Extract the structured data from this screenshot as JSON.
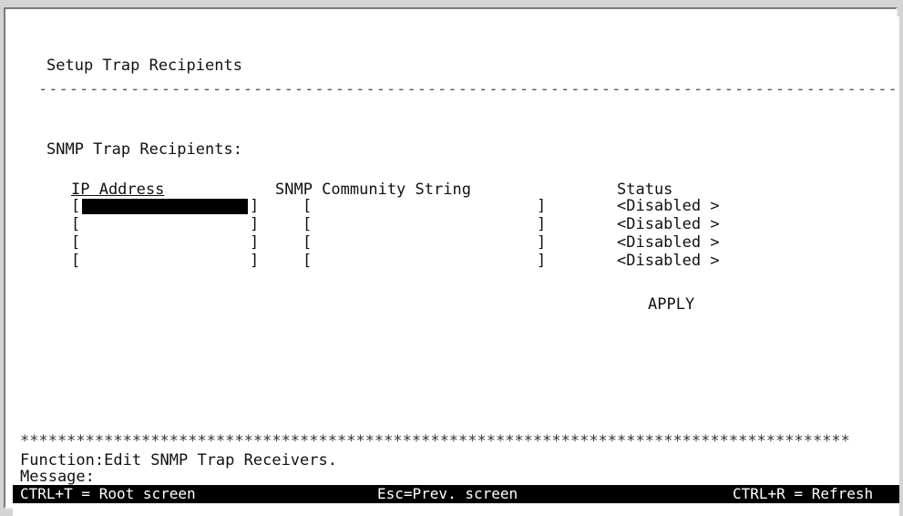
{
  "screen": {
    "title": "Setup Trap Recipients",
    "section_label": "SNMP Trap Recipients:",
    "columns": {
      "ip": "IP Address",
      "community": "SNMP Community String",
      "status": "Status"
    },
    "rows": [
      {
        "ip": "",
        "community": "",
        "status": "<Disabled >"
      },
      {
        "ip": "",
        "community": "",
        "status": "<Disabled >"
      },
      {
        "ip": "",
        "community": "",
        "status": "<Disabled >"
      },
      {
        "ip": "",
        "community": "",
        "status": "<Disabled >"
      }
    ],
    "apply_label": "APPLY",
    "function_text": "Function:Edit SNMP Trap Receivers.",
    "message_label": "Message:",
    "bottom_bar": {
      "root": "CTRL+T = Root screen",
      "prev": "Esc=Prev. screen",
      "refresh": "CTRL+R = Refresh"
    }
  }
}
